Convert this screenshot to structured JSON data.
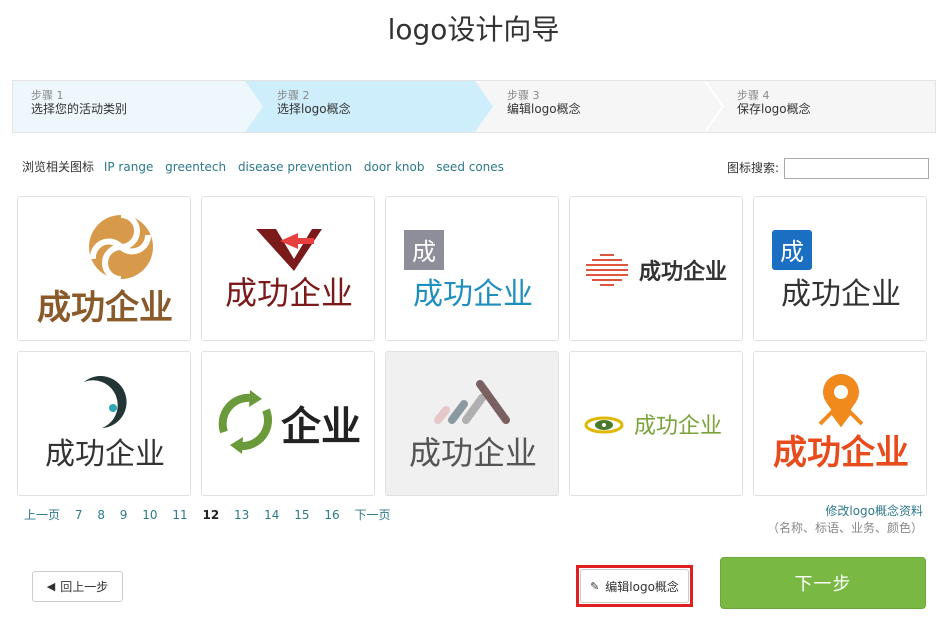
{
  "page": {
    "title": "logo设计向导"
  },
  "steps": [
    {
      "num": "步骤 1",
      "name": "选择您的活动类别"
    },
    {
      "num": "步骤 2",
      "name": "选择logo概念"
    },
    {
      "num": "步骤 3",
      "name": "编辑logo概念"
    },
    {
      "num": "步骤 4",
      "name": "保存logo概念"
    }
  ],
  "related": {
    "label": "浏览相关图标",
    "tags": [
      "IP range",
      "greentech",
      "disease prevention",
      "door knob",
      "seed cones"
    ]
  },
  "search": {
    "label": "图标搜索:",
    "value": ""
  },
  "logos": [
    {
      "text": "成功企业",
      "icon": "circle-swirl-icon",
      "color": "#8b5a2b"
    },
    {
      "text": "成功企业",
      "icon": "red-v-arrow-icon",
      "color": "#7a1a1a"
    },
    {
      "text": "成功企业",
      "badge": "成",
      "icon": "gray-square-badge-icon",
      "color": "#1f8fbf"
    },
    {
      "text": "成功企业",
      "icon": "red-stripes-diamond-icon",
      "color": "#333333"
    },
    {
      "text": "成功企业",
      "badge": "成",
      "icon": "blue-square-badge-icon",
      "color": "#333333"
    },
    {
      "text": "成功企业",
      "icon": "dark-crescent-icon",
      "color": "#333333"
    },
    {
      "text": "企业",
      "icon": "green-recycle-arrows-icon",
      "color": "#222222"
    },
    {
      "text": "成功企业",
      "icon": "diagonal-bars-icon",
      "color": "#555555"
    },
    {
      "text": "成功企业",
      "icon": "yellow-eye-icon",
      "color": "#7aa33a"
    },
    {
      "text": "成功企业",
      "icon": "orange-pin-icon",
      "color": "#e84c1c"
    }
  ],
  "pager": {
    "prev": "上一页",
    "pages": [
      "7",
      "8",
      "9",
      "10",
      "11",
      "12",
      "13",
      "14",
      "15",
      "16"
    ],
    "current": "12",
    "next": "下一页"
  },
  "modify": {
    "link": "修改logo概念资料",
    "sub": "（名称、标语、业务、颜色）"
  },
  "buttons": {
    "back": "回上一步",
    "edit": "编辑logo概念",
    "next": "下一步"
  },
  "colors": {
    "accent": "#79b943",
    "link": "#2d7a8a",
    "highlight": "#e02020",
    "step_active": "#cfeefb"
  }
}
